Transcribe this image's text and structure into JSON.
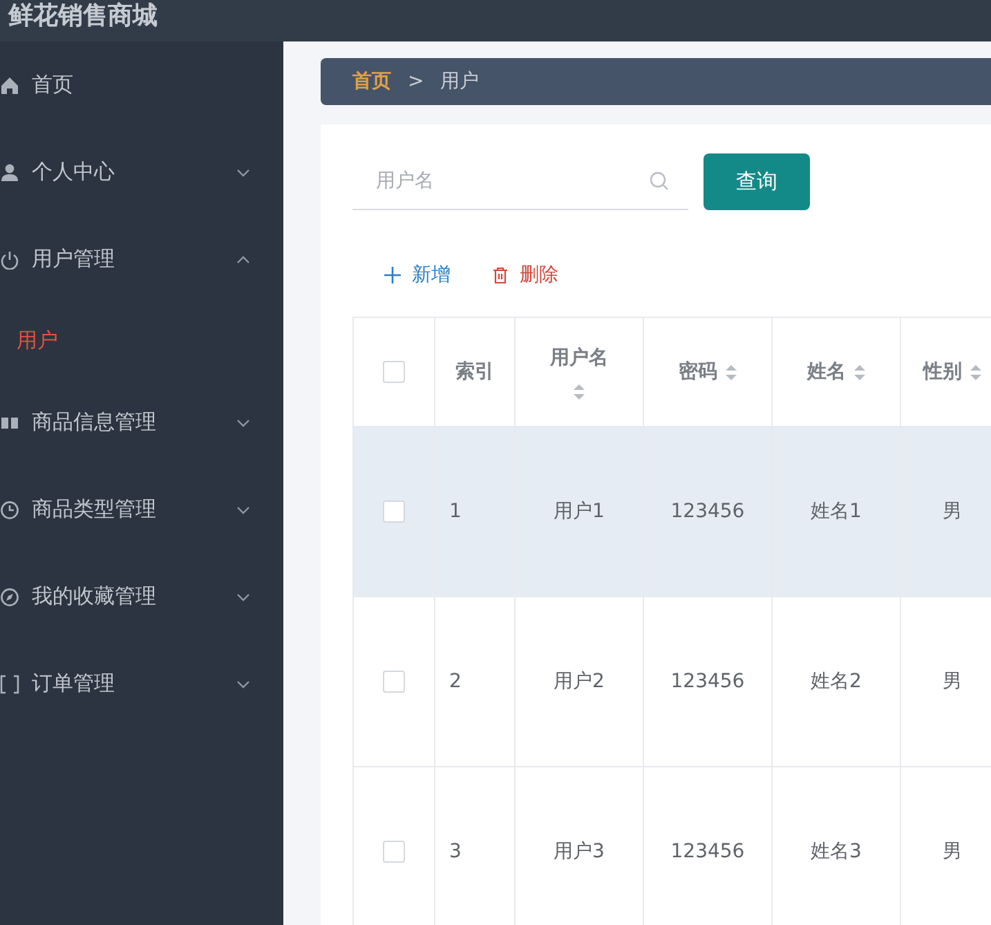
{
  "app_title": "鲜花销售商城",
  "sidebar": {
    "items": [
      {
        "label": "首页"
      },
      {
        "label": "个人中心",
        "expanded": false
      },
      {
        "label": "用户管理",
        "expanded": true,
        "children": [
          {
            "label": "用户",
            "selected": true
          }
        ]
      },
      {
        "label": "商品信息管理",
        "expanded": false
      },
      {
        "label": "商品类型管理",
        "expanded": false
      },
      {
        "label": "我的收藏管理",
        "expanded": false
      },
      {
        "label": "订单管理",
        "expanded": false
      }
    ]
  },
  "breadcrumb": [
    {
      "label": "首页",
      "current": false
    },
    {
      "label": "用户",
      "current": true
    }
  ],
  "breadcrumb_separator": ">",
  "search": {
    "placeholder": "用户名",
    "button": "查询"
  },
  "actions": [
    {
      "kind": "add",
      "label": "新增"
    },
    {
      "kind": "delete",
      "label": "删除"
    }
  ],
  "table": {
    "columns": [
      {
        "label": "索引",
        "sortable": false
      },
      {
        "label": "用户名",
        "sortable": true
      },
      {
        "label": "密码",
        "sortable": true
      },
      {
        "label": "姓名",
        "sortable": true
      },
      {
        "label": "性别",
        "sortable": true
      }
    ],
    "header_checked": false,
    "rows": [
      {
        "checked": false,
        "hovered": true,
        "cells": [
          "1",
          "用户1",
          "123456",
          "姓名1",
          "男"
        ]
      },
      {
        "checked": false,
        "hovered": false,
        "cells": [
          "2",
          "用户2",
          "123456",
          "姓名2",
          "男"
        ]
      },
      {
        "checked": false,
        "hovered": false,
        "cells": [
          "3",
          "用户3",
          "123456",
          "姓名3",
          "男"
        ]
      }
    ]
  }
}
